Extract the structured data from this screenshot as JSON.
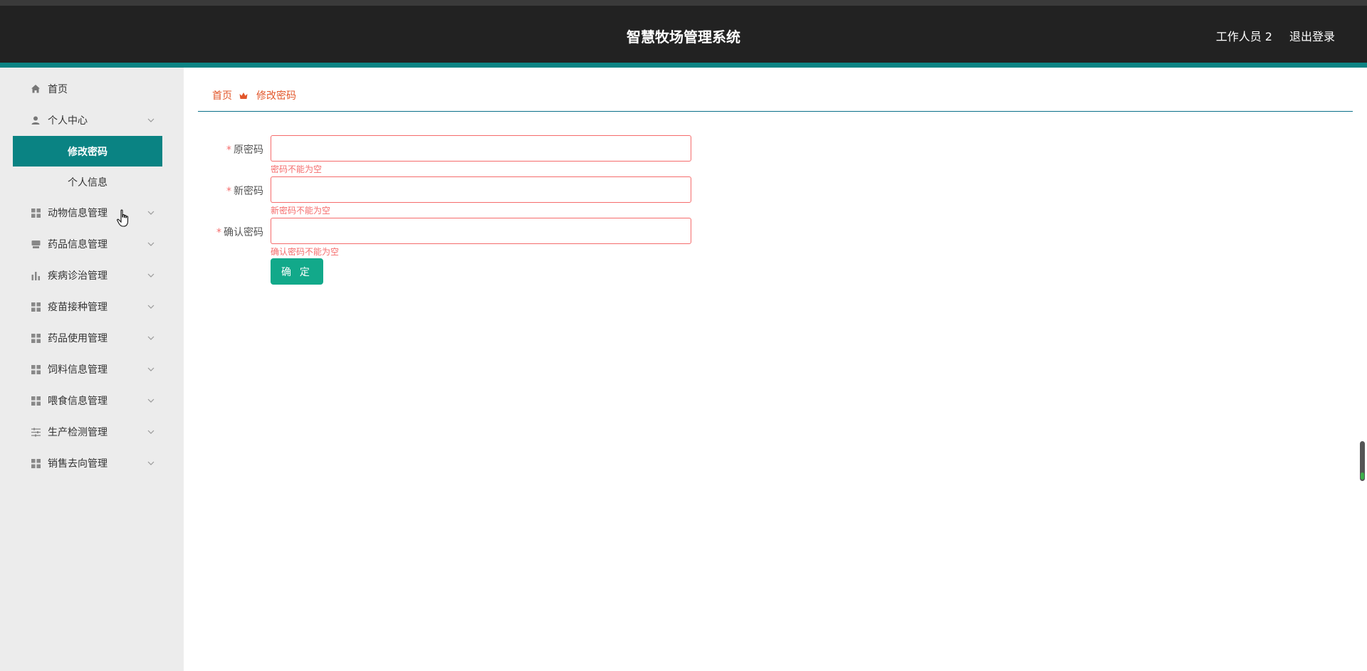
{
  "header": {
    "title": "智慧牧场管理系统",
    "user": "工作人员 2",
    "logout": "退出登录"
  },
  "sidebar": {
    "items": [
      {
        "label": "首页",
        "icon": "home-icon",
        "expandable": false
      },
      {
        "label": "个人中心",
        "icon": "user-icon",
        "expandable": true
      },
      {
        "label": "动物信息管理",
        "icon": "grid-icon",
        "expandable": true
      },
      {
        "label": "药品信息管理",
        "icon": "box-icon",
        "expandable": true
      },
      {
        "label": "疾病诊治管理",
        "icon": "bar-chart-icon",
        "expandable": true
      },
      {
        "label": "疫苗接种管理",
        "icon": "grid-icon",
        "expandable": true
      },
      {
        "label": "药品使用管理",
        "icon": "grid-icon",
        "expandable": true
      },
      {
        "label": "饲料信息管理",
        "icon": "grid-icon",
        "expandable": true
      },
      {
        "label": "喂食信息管理",
        "icon": "grid-icon",
        "expandable": true
      },
      {
        "label": "生产检测管理",
        "icon": "sliders-icon",
        "expandable": true
      },
      {
        "label": "销售去向管理",
        "icon": "grid-icon",
        "expandable": true
      }
    ],
    "submenu": [
      {
        "label": "修改密码",
        "active": true
      },
      {
        "label": "个人信息",
        "active": false
      }
    ]
  },
  "breadcrumb": {
    "home": "首页",
    "current": "修改密码"
  },
  "form": {
    "fields": [
      {
        "label": "原密码",
        "value": "",
        "error": "密码不能为空"
      },
      {
        "label": "新密码",
        "value": "",
        "error": "新密码不能为空"
      },
      {
        "label": "确认密码",
        "value": "",
        "error": "确认密码不能为空"
      }
    ],
    "required_mark": "*",
    "submit_label": "确 定"
  },
  "colors": {
    "header_bg": "#222222",
    "accent": "#0a8383",
    "error": "#f56c6c",
    "breadcrumb": "#e2562a",
    "button": "#12a98a"
  }
}
